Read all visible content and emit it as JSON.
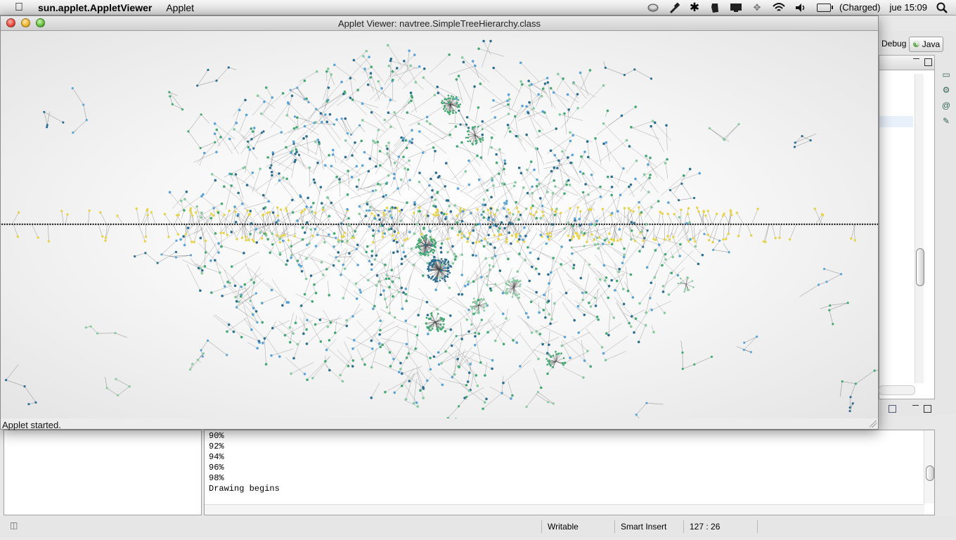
{
  "menubar": {
    "apple_icon": "apple-logo-icon",
    "app_name": "sun.applet.AppletViewer",
    "menus": [
      "Applet"
    ],
    "battery_status": "(Charged)",
    "clock": "jue 15:09",
    "status_icons": [
      "time-machine-icon",
      "eyedropper-icon",
      "bluetooth-icon",
      "evernote-icon",
      "display-icon",
      "network-icon",
      "wifi-icon",
      "volume-icon",
      "battery-icon",
      "spotlight-icon"
    ]
  },
  "applet_window": {
    "title": "Applet Viewer: navtree.SimpleTreeHierarchy.class",
    "status": "Applet started."
  },
  "ide": {
    "perspectives": {
      "debug": "Debug",
      "java": "Java"
    },
    "console_lines": [
      "90%",
      "92%",
      "94%",
      "96%",
      "98%",
      "Drawing begins"
    ],
    "statusbar": {
      "writable": "Writable",
      "insert_mode": "Smart Insert",
      "position": "127 : 26"
    }
  },
  "graph": {
    "node_colors": [
      "#2c6e8f",
      "#5aa3d6",
      "#43a873",
      "#88c9a0",
      "#e6d34a",
      "#1e1e1e"
    ],
    "edge_color": "#444444",
    "background": "#f4f4f4"
  }
}
